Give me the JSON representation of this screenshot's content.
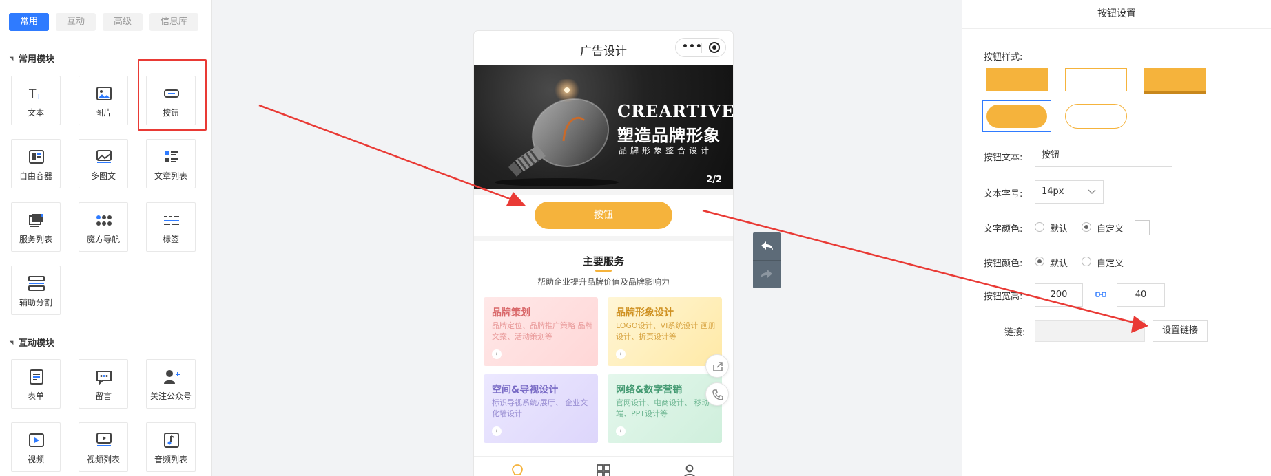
{
  "left_panel": {
    "tabs": [
      {
        "label": "常用"
      },
      {
        "label": "互动"
      },
      {
        "label": "高级"
      },
      {
        "label": "信息库"
      }
    ],
    "common_section_title": "常用模块",
    "common_modules": [
      {
        "label": "文本",
        "icon": "text-icon"
      },
      {
        "label": "图片",
        "icon": "image-icon"
      },
      {
        "label": "按钮",
        "icon": "button-icon"
      },
      {
        "label": "自由容器",
        "icon": "container-icon"
      },
      {
        "label": "多图文",
        "icon": "multi-image-icon"
      },
      {
        "label": "文章列表",
        "icon": "article-list-icon"
      },
      {
        "label": "服务列表",
        "icon": "service-list-icon"
      },
      {
        "label": "魔方导航",
        "icon": "cube-nav-icon"
      },
      {
        "label": "标签",
        "icon": "tag-icon"
      },
      {
        "label": "辅助分割",
        "icon": "divider-icon"
      }
    ],
    "interactive_section_title": "互动模块",
    "interactive_modules": [
      {
        "label": "表单",
        "icon": "form-icon"
      },
      {
        "label": "留言",
        "icon": "message-icon"
      },
      {
        "label": "关注公众号",
        "icon": "follow-icon"
      },
      {
        "label": "视频",
        "icon": "video-icon"
      },
      {
        "label": "视频列表",
        "icon": "video-list-icon"
      },
      {
        "label": "音频列表",
        "icon": "audio-list-icon"
      }
    ]
  },
  "phone": {
    "title": "广告设计",
    "banner": {
      "en": "CREARTIVE",
      "cn": "塑造品牌形象",
      "sub": "品牌形象整合设计",
      "page": "2/2"
    },
    "button_label": "按钮",
    "services": {
      "title": "主要服务",
      "subtitle": "帮助企业提升品牌价值及品牌影响力",
      "cards": [
        {
          "title": "品牌策划",
          "desc": "品牌定位、品牌推广策略 品牌文案、活动策划等",
          "color": "#e07a7a"
        },
        {
          "title": "品牌形象设计",
          "desc": "LOGO设计、VI系统设计 画册设计、折页设计等",
          "color": "#d49a2a"
        },
        {
          "title": "空间&导视设计",
          "desc": "标识导视系统/展厅、 企业文化墙设计",
          "color": "#7d6fc9"
        },
        {
          "title": "网络&数字营销",
          "desc": "官网设计、电商设计、 移动端、PPT设计等",
          "color": "#4aa37a"
        }
      ]
    }
  },
  "right_panel": {
    "header": "按钮设置",
    "style_label": "按钮样式:",
    "text_label": "按钮文本:",
    "text_value": "按钮",
    "size_label": "文本字号:",
    "size_value": "14px",
    "text_color_label": "文字颜色:",
    "text_color_options": [
      "默认",
      "自定义"
    ],
    "btn_color_label": "按钮颜色:",
    "btn_color_options": [
      "默认",
      "自定义"
    ],
    "wh_label": "按钮宽高:",
    "width_value": "200",
    "height_value": "40",
    "link_label": "链接:",
    "link_button": "设置链接"
  },
  "colors": {
    "accent_blue": "#2f7bff",
    "button_orange": "#f5b33c",
    "annotation_red": "#e93a35"
  }
}
